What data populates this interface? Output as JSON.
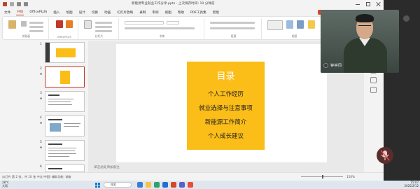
{
  "window": {
    "doc_title": "新能源专业就业工作分享.pptx - 上次保存时间: 10 分钟前"
  },
  "menu": {
    "tabs": [
      "文件",
      "开始",
      "OfficePLUS",
      "插入",
      "绘图",
      "设计",
      "切换",
      "动画",
      "幻灯片放映",
      "录制",
      "审阅",
      "视图",
      "帮助",
      "PDF工具集",
      "智能"
    ],
    "active_index": 1
  },
  "ribbon": {
    "groups": [
      "剪贴板",
      "OfficePLUS",
      "幻灯片",
      "字体",
      "段落",
      "绘图",
      "编辑"
    ]
  },
  "thumbnails": [
    {
      "num": "1",
      "selected": false
    },
    {
      "num": "2",
      "selected": true
    },
    {
      "num": "3",
      "selected": false
    },
    {
      "num": "4",
      "selected": false
    },
    {
      "num": "5",
      "selected": false
    },
    {
      "num": "6",
      "selected": false
    }
  ],
  "slide": {
    "title": "目录",
    "items": [
      "个人工作经历",
      "就业选择与注意事项",
      "新能源工作简介",
      "个人成长建议"
    ],
    "box_color": "#fbbd18"
  },
  "notes_placeholder": "单击此处添加备注",
  "statusbar": {
    "left": "幻灯片 第 2 张，共 10 张   中文(中国)   辅助功能: 调查",
    "zoom": "150%"
  },
  "webcam": {
    "name": "钟钟同"
  },
  "taskbar": {
    "weather_temp": "28°C",
    "weather_desc": "大雨",
    "search_text": "搜索",
    "time": "15:07",
    "date": "2025/2/12"
  },
  "colors": {
    "accent": "#b7472a",
    "slide_box": "#fbbd18"
  }
}
